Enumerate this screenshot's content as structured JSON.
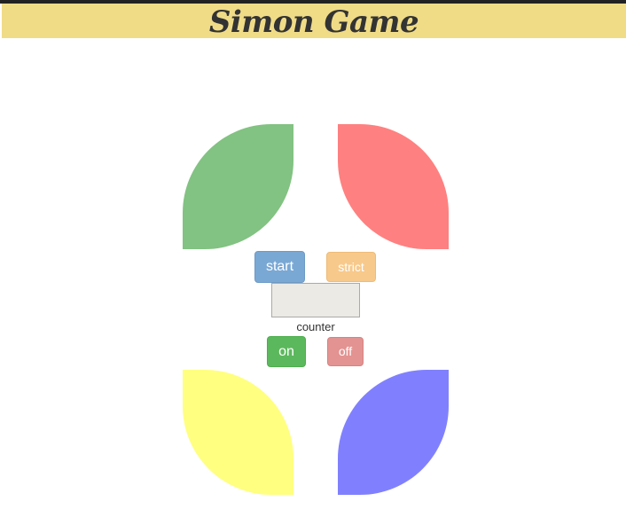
{
  "header": {
    "title": "Simon Game"
  },
  "pads": {
    "green": {
      "color": "#82c282"
    },
    "red": {
      "color": "#ff8080"
    },
    "yellow": {
      "color": "#ffff80"
    },
    "blue": {
      "color": "#8080ff"
    }
  },
  "controls": {
    "start_label": "start",
    "strict_label": "strict",
    "on_label": "on",
    "off_label": "off"
  },
  "counter": {
    "value": "",
    "label": "counter"
  },
  "colors": {
    "header_bg": "#f0dc87",
    "start_btn": "#7aa8d4",
    "strict_btn": "#f7c98b",
    "on_btn": "#5cb85c",
    "off_btn": "#e39391"
  }
}
